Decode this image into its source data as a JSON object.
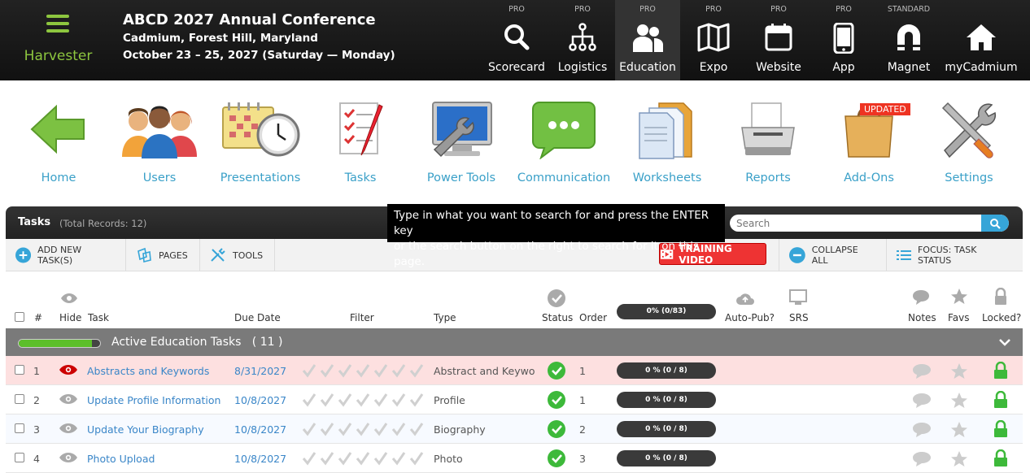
{
  "brand": {
    "name": "Harvester"
  },
  "conference": {
    "title": "ABCD 2027 Annual Conference",
    "location": "Cadmium, Forest Hill, Maryland",
    "dates": "October 23 – 25, 2027 (Saturday — Monday)"
  },
  "topnav": [
    {
      "tier": "PRO",
      "label": "Scorecard",
      "icon": "search-icon"
    },
    {
      "tier": "PRO",
      "label": "Logistics",
      "icon": "network-icon"
    },
    {
      "tier": "PRO",
      "label": "Education",
      "icon": "people-icon"
    },
    {
      "tier": "PRO",
      "label": "Expo",
      "icon": "map-icon"
    },
    {
      "tier": "PRO",
      "label": "Website",
      "icon": "calendar-window-icon"
    },
    {
      "tier": "PRO",
      "label": "App",
      "icon": "phone-icon"
    },
    {
      "tier": "STANDARD",
      "label": "Magnet",
      "icon": "magnet-icon"
    },
    {
      "tier": "",
      "label": "myCadmium",
      "icon": "home-icon"
    }
  ],
  "iconnav": [
    {
      "label": "Home",
      "icon": "green-arrow-icon"
    },
    {
      "label": "Users",
      "icon": "users-group-icon"
    },
    {
      "label": "Presentations",
      "icon": "calendar-clock-icon"
    },
    {
      "label": "Tasks",
      "icon": "checklist-icon"
    },
    {
      "label": "Power Tools",
      "icon": "monitor-wrench-icon"
    },
    {
      "label": "Communication",
      "icon": "chat-bubble-icon"
    },
    {
      "label": "Worksheets",
      "icon": "folder-docs-icon"
    },
    {
      "label": "Reports",
      "icon": "printer-icon"
    },
    {
      "label": "Add-Ons",
      "icon": "shopping-bag-icon"
    },
    {
      "label": "Settings",
      "icon": "tools-icon"
    }
  ],
  "updated_badge": "UPDATED",
  "panel": {
    "title": "Tasks",
    "total": "(Total Records: 12)"
  },
  "tooltip": {
    "line1": "Type in what you want to search for and press the ENTER key",
    "line2": "or the search button on the right to search for it on this page."
  },
  "search": {
    "placeholder": "Search"
  },
  "toolbar": {
    "add": "ADD NEW TASK(S)",
    "pages": "PAGES",
    "tools": "TOOLS",
    "training": "TRAINING VIDEO",
    "collapse": "COLLAPSE ALL",
    "focus": "FOCUS: TASK STATUS"
  },
  "columns": {
    "num": "#",
    "hide": "Hide",
    "task": "Task",
    "due": "Due Date",
    "filter": "Filter",
    "type": "Type",
    "status": "Status",
    "order": "Order",
    "progress": "0% (0/83)",
    "autopub": "Auto-Pub?",
    "srs": "SRS",
    "notes": "Notes",
    "favs": "Favs",
    "locked": "Locked?"
  },
  "group": {
    "title": "Active Education Tasks",
    "count": "( 11 )",
    "progress": 0.9
  },
  "rows": [
    {
      "num": "1",
      "task": "Abstracts and Keywords",
      "due": "8/31/2027",
      "type": "Abstract and Keywo...",
      "order": "1",
      "progress": "0 % (0 / 8)",
      "highlight": true
    },
    {
      "num": "2",
      "task": "Update Profile Information",
      "due": "10/8/2027",
      "type": "Profile",
      "order": "1",
      "progress": "0 % (0 / 8)",
      "highlight": false
    },
    {
      "num": "3",
      "task": "Update Your Biography",
      "due": "10/8/2027",
      "type": "Biography",
      "order": "2",
      "progress": "0 % (0 / 8)",
      "highlight": false
    },
    {
      "num": "4",
      "task": "Photo Upload",
      "due": "10/8/2027",
      "type": "Photo",
      "order": "3",
      "progress": "0 % (0 / 8)",
      "highlight": false
    }
  ],
  "colors": {
    "accent": "#8dc63f",
    "link": "#3a86c8",
    "search": "#36a5d8",
    "highlight": "#fde0e0",
    "group": "#7a7a7a"
  }
}
